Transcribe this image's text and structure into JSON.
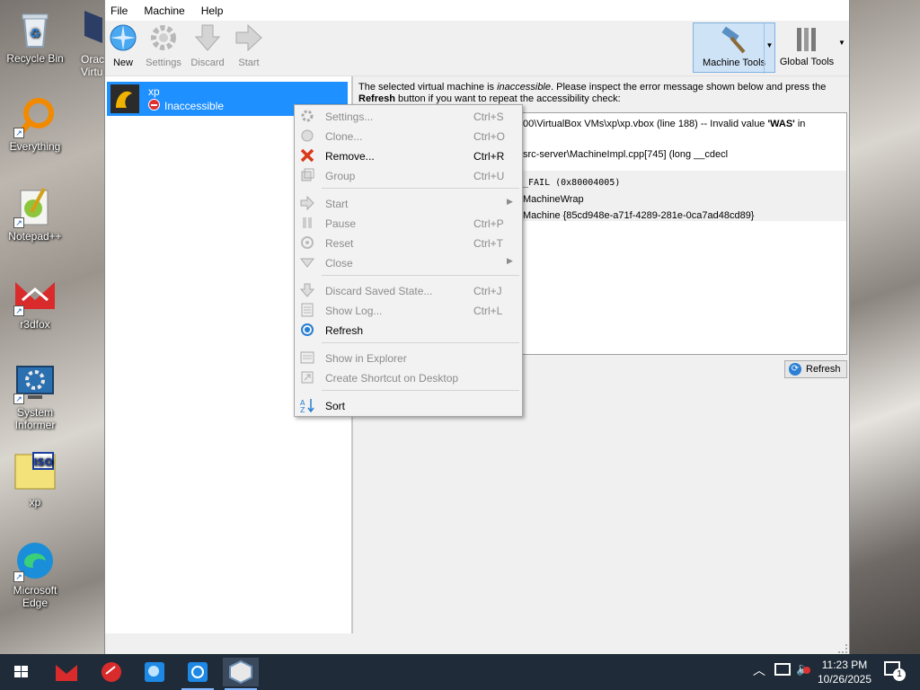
{
  "desktop": {
    "icons": [
      {
        "label": "Recycle Bin"
      },
      {
        "label": "Everything"
      },
      {
        "label": "Notepad++"
      },
      {
        "label": "r3dfox"
      },
      {
        "label": "System Informer"
      },
      {
        "label": "xp"
      },
      {
        "label": "Microsoft Edge"
      }
    ],
    "partial_icon_label": "Orac\nVirtu"
  },
  "window": {
    "menus": [
      "File",
      "Machine",
      "Help"
    ],
    "toolbar": {
      "new": "New",
      "settings": "Settings",
      "discard": "Discard",
      "start": "Start",
      "machine_tools": "Machine Tools",
      "global_tools": "Global Tools"
    },
    "vm": {
      "name": "xp",
      "state": "Inaccessible"
    },
    "details": {
      "intro_a": "The selected virtual machine is ",
      "intro_em": "inaccessible",
      "intro_b": ". Please inspect the error message shown below and press the",
      "intro_bold": "Refresh",
      "intro_c": " button if you want to repeat the accessibility check:",
      "err_line1_a": "00\\VirtualBox VMs\\xp\\xp.vbox (line 188) -- Invalid value ",
      "err_line1_bold": "'WAS'",
      "err_line1_b": " in",
      "err_line2": "src-server\\MachineImpl.cpp[745] (long __cdecl",
      "err_line3": "_FAIL (0x80004005)",
      "err_line4": "MachineWrap",
      "err_line5": "Machine {85cd948e-a71f-4289-281e-0ca7ad48cd89}",
      "refresh": "Refresh"
    }
  },
  "context_menu": {
    "items": [
      {
        "label": "Settings...",
        "shortcut": "Ctrl+S"
      },
      {
        "label": "Clone...",
        "shortcut": "Ctrl+O"
      },
      {
        "label": "Remove...",
        "shortcut": "Ctrl+R"
      },
      {
        "label": "Group",
        "shortcut": "Ctrl+U"
      },
      {
        "label": "Start",
        "shortcut": ""
      },
      {
        "label": "Pause",
        "shortcut": "Ctrl+P"
      },
      {
        "label": "Reset",
        "shortcut": "Ctrl+T"
      },
      {
        "label": "Close",
        "shortcut": ""
      },
      {
        "label": "Discard Saved State...",
        "shortcut": "Ctrl+J"
      },
      {
        "label": "Show Log...",
        "shortcut": "Ctrl+L"
      },
      {
        "label": "Refresh",
        "shortcut": ""
      },
      {
        "label": "Show in Explorer",
        "shortcut": ""
      },
      {
        "label": "Create Shortcut on Desktop",
        "shortcut": ""
      },
      {
        "label": "Sort",
        "shortcut": ""
      }
    ]
  },
  "taskbar": {
    "time": "11:23 PM",
    "date": "10/26/2025",
    "notifications": "1"
  }
}
